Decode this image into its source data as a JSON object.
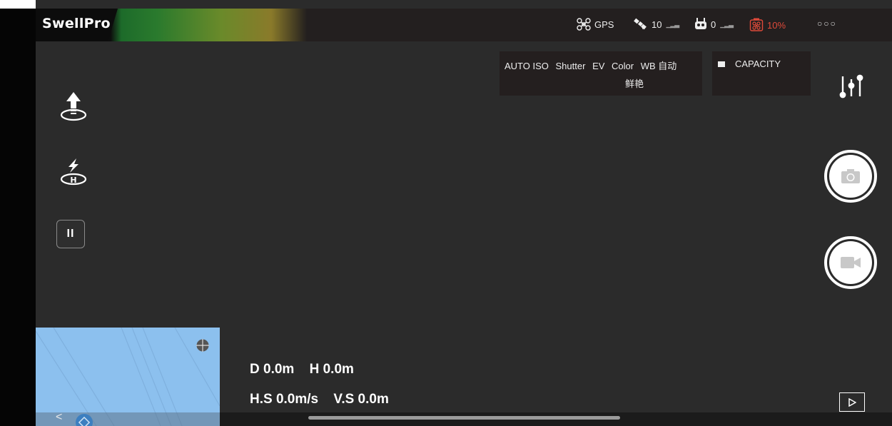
{
  "app": {
    "logo_text": "SwellPro"
  },
  "status_bar": {
    "gps_label": "GPS",
    "satellite_count": "10",
    "remote_signal": "0",
    "battery_level": "10%",
    "more_icon": "more-dots-icon",
    "battery_color": "#e04a3a"
  },
  "camera_settings": {
    "iso": "AUTO ISO",
    "shutter": "Shutter",
    "ev": "EV",
    "color_label": "Color",
    "wb_label": "WB 自动",
    "color_value": "鲜艳"
  },
  "storage": {
    "capacity_label": "CAPACITY"
  },
  "telemetry": {
    "distance": "D 0.0m",
    "height": "H 0.0m",
    "horizontal_speed": "H.S 0.0m/s",
    "vertical_speed": "V.S 0.0m"
  },
  "left_controls": [
    {
      "name": "takeoff",
      "icon": "takeoff-icon"
    },
    {
      "name": "return-home",
      "icon": "return-home-icon"
    },
    {
      "name": "pause",
      "icon": "pause-icon"
    }
  ],
  "right_controls": [
    {
      "name": "camera-settings",
      "icon": "sliders-icon"
    },
    {
      "name": "photo-shutter",
      "icon": "camera-icon"
    },
    {
      "name": "video-record",
      "icon": "video-camera-icon"
    },
    {
      "name": "playback",
      "icon": "play-icon"
    }
  ],
  "map": {
    "back_icon": "chevron-left-icon",
    "locate_icon": "crosshair-icon"
  }
}
